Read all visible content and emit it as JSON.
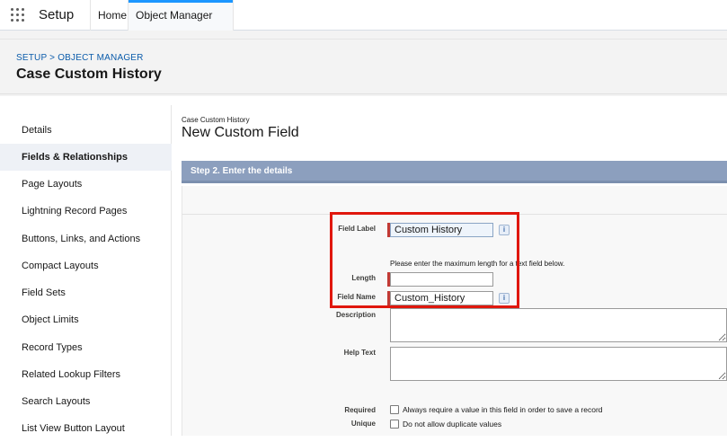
{
  "topnav": {
    "app_name": "Setup",
    "tabs": [
      {
        "label": "Home"
      },
      {
        "label": "Object Manager"
      }
    ]
  },
  "header": {
    "breadcrumb": [
      "SETUP",
      "OBJECT MANAGER"
    ],
    "breadcrumb_separator": ">",
    "title": "Case Custom History"
  },
  "sidebar": {
    "items": [
      {
        "label": "Details"
      },
      {
        "label": "Fields & Relationships",
        "active": true
      },
      {
        "label": "Page Layouts"
      },
      {
        "label": "Lightning Record Pages"
      },
      {
        "label": "Buttons, Links, and Actions"
      },
      {
        "label": "Compact Layouts"
      },
      {
        "label": "Field Sets"
      },
      {
        "label": "Object Limits"
      },
      {
        "label": "Record Types"
      },
      {
        "label": "Related Lookup Filters"
      },
      {
        "label": "Search Layouts"
      },
      {
        "label": "List View Button Layout"
      }
    ]
  },
  "main": {
    "object_label": "Case Custom History",
    "title": "New Custom Field",
    "step_label": "Step 2. Enter the details",
    "form": {
      "field_label": {
        "label": "Field Label",
        "value": "Custom History"
      },
      "length_hint": "Please enter the maximum length for a text field below.",
      "length": {
        "label": "Length",
        "value": ""
      },
      "field_name": {
        "label": "Field Name",
        "value": "Custom_History"
      },
      "description": {
        "label": "Description",
        "value": ""
      },
      "help_text": {
        "label": "Help Text",
        "value": ""
      },
      "required": {
        "label": "Required",
        "text": "Always require a value in this field in order to save a record",
        "checked": false
      },
      "unique": {
        "label": "Unique",
        "text": "Do not allow duplicate values",
        "checked": false
      }
    },
    "info_icon_glyph": "i"
  },
  "colors": {
    "accent": "#1b96ff",
    "link": "#0b5cab",
    "step_bar": "#8c9fbe",
    "required_marker": "#c23934",
    "highlight_box": "#e0170d"
  }
}
